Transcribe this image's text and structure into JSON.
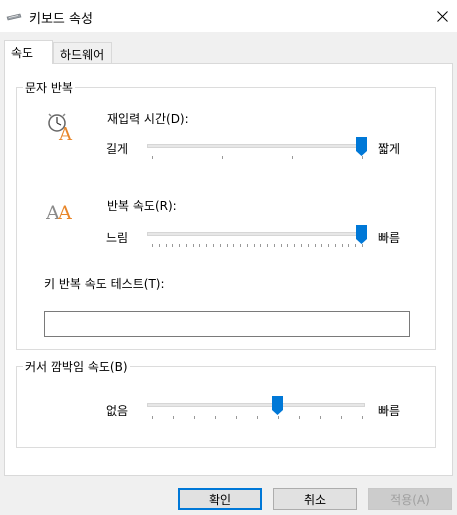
{
  "window": {
    "title": "키보드 속성",
    "close_icon": "close-icon",
    "title_icon": "keyboard-icon"
  },
  "tabs": [
    {
      "label": "속도",
      "active": true
    },
    {
      "label": "하드웨어",
      "active": false
    }
  ],
  "char_repeat": {
    "group_title": "문자 반복",
    "delay": {
      "label": "재입력 시간(D):",
      "left": "길게",
      "right": "짧게",
      "value": 3,
      "min": 0,
      "max": 3,
      "icon": "clock-a-icon"
    },
    "rate": {
      "label": "반복 속도(R):",
      "left": "느림",
      "right": "빠름",
      "value": 31,
      "min": 0,
      "max": 31,
      "icon": "double-a-icon"
    },
    "test": {
      "label": "키 반복 속도 테스트(T):",
      "value": ""
    }
  },
  "cursor_blink": {
    "group_title": "커서 깜박임 속도(B)",
    "left": "없음",
    "right": "빠름",
    "value": 0.6
  },
  "buttons": {
    "ok": "확인",
    "cancel": "취소",
    "apply": "적용(A)"
  },
  "colors": {
    "accent": "#0078d7",
    "icon_orange": "#e8862a"
  }
}
